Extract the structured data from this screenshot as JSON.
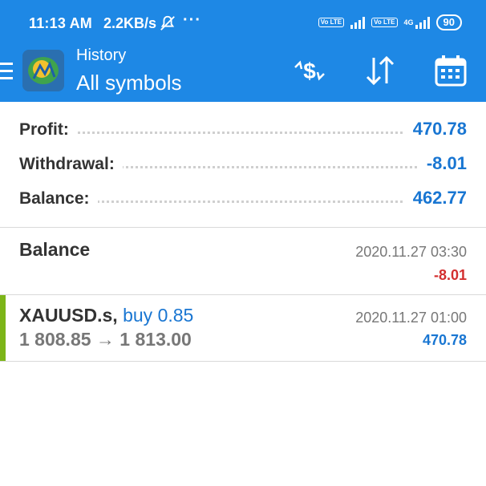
{
  "status_bar": {
    "time": "11:13 AM",
    "speed": "2.2KB/s",
    "dots": "···",
    "volte1": "Vo LTE",
    "volte2": "Vo LTE",
    "net": "4G",
    "battery": "90"
  },
  "header": {
    "subtitle": "History",
    "title": "All symbols",
    "icons": [
      "menu-icon",
      "metatrader-logo",
      "currency-exchange-icon",
      "sort-icon",
      "calendar-icon"
    ]
  },
  "summary": [
    {
      "label": "Profit:",
      "value": "470.78"
    },
    {
      "label": "Withdrawal:",
      "value": "-8.01"
    },
    {
      "label": "Balance:",
      "value": "462.77"
    }
  ],
  "deals": [
    {
      "title": "Balance",
      "date": "2020.11.27 03:30",
      "amount": "-8.01",
      "amount_color": "#d32f2f"
    },
    {
      "symbol": "XAUUSD.s,",
      "direction": "buy 0.85",
      "prices": "1 808.85 → 1 813.00",
      "date": "2020.11.27 01:00",
      "amount": "470.78",
      "amount_color": "#1976d2"
    }
  ],
  "colors": {
    "accent": "#1e88e5",
    "positive": "#1976d2",
    "negative": "#d32f2f",
    "buy_marker": "#7cb518"
  }
}
